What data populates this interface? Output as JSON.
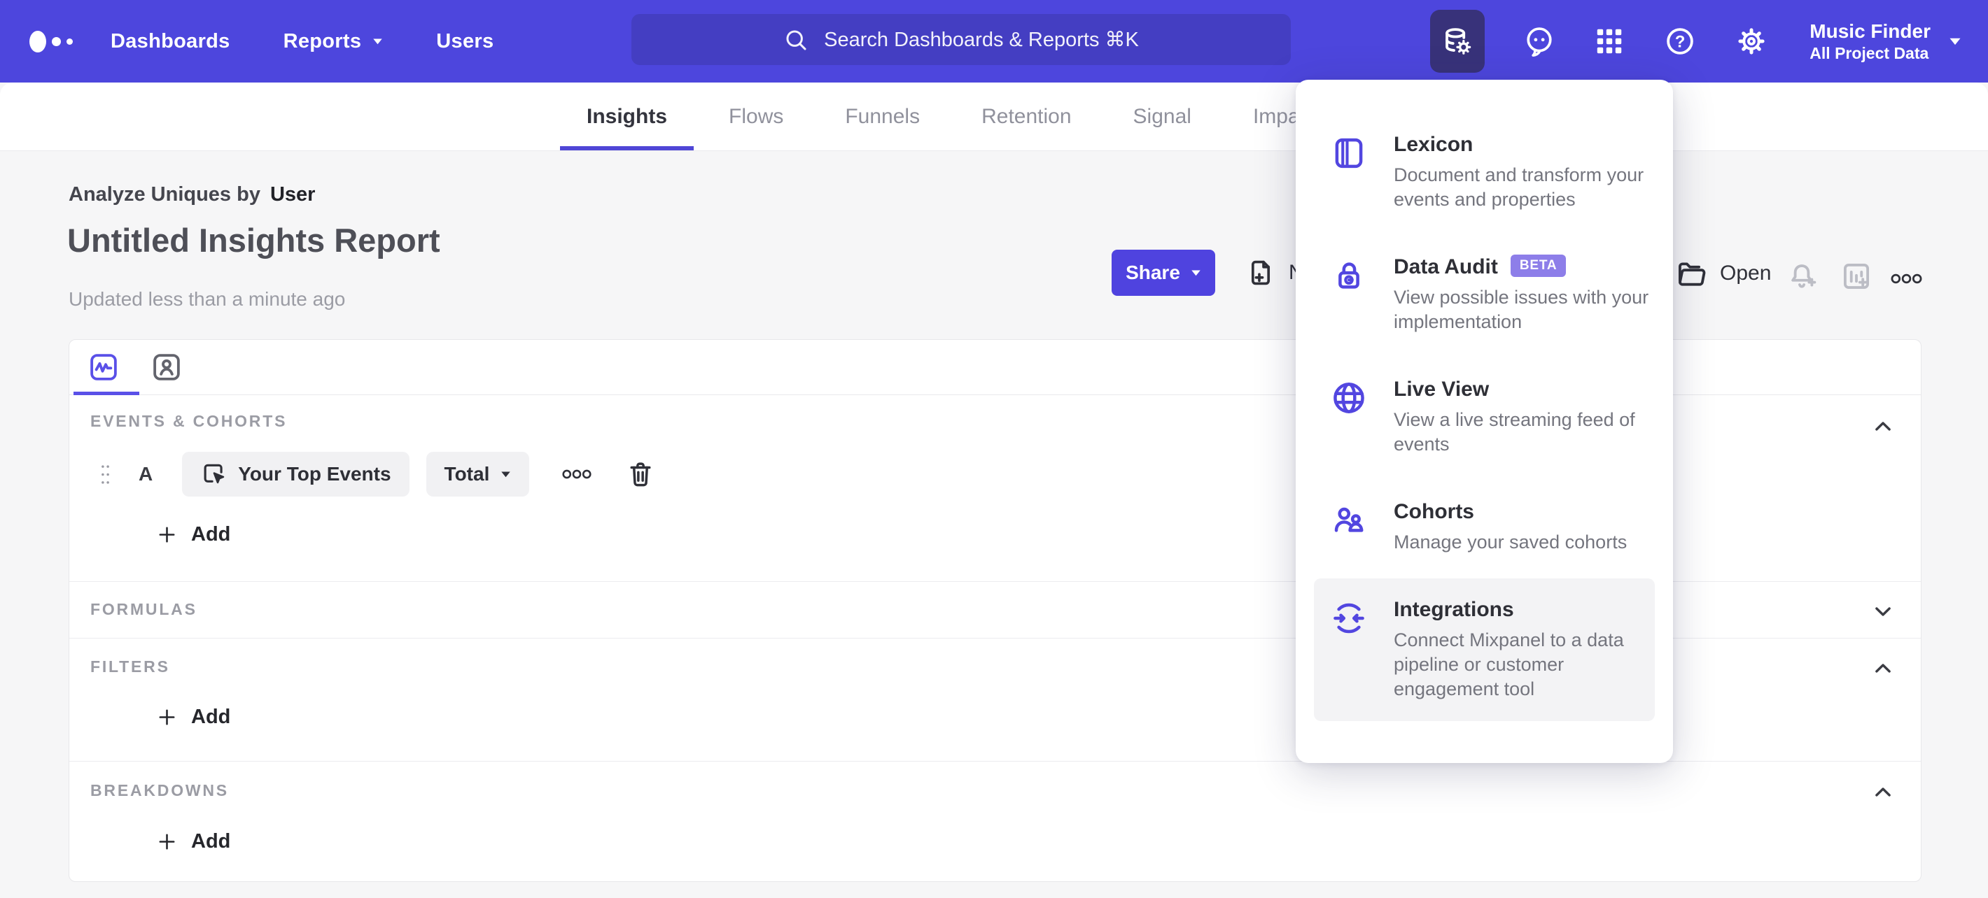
{
  "nav": {
    "items": [
      "Dashboards",
      "Reports",
      "Users"
    ],
    "search_placeholder": "Search Dashboards & Reports ⌘K",
    "project": {
      "name": "Music Finder",
      "scope": "All Project Data"
    }
  },
  "tabs": {
    "items": [
      "Insights",
      "Flows",
      "Funnels",
      "Retention",
      "Signal",
      "Impact"
    ],
    "active": "Insights"
  },
  "report": {
    "analyze_label": "Analyze Uniques by",
    "analyze_value": "User",
    "title": "Untitled Insights Report",
    "updated": "Updated less than a minute ago",
    "actions": {
      "share": "Share",
      "new": "New",
      "open": "Open"
    }
  },
  "builder": {
    "events_header": "EVENTS & COHORTS",
    "row": {
      "letter": "A",
      "event": "Your Top Events",
      "metric": "Total"
    },
    "add_label": "Add",
    "formulas_header": "FORMULAS",
    "filters_header": "FILTERS",
    "breakdowns_header": "BREAKDOWNS"
  },
  "menu": {
    "items": [
      {
        "title": "Lexicon",
        "description": "Document and transform your events and properties"
      },
      {
        "title": "Data Audit",
        "badge": "BETA",
        "description": "View possible issues with your implementation"
      },
      {
        "title": "Live View",
        "description": "View a live streaming feed of events"
      },
      {
        "title": "Cohorts",
        "description": "Manage your saved cohorts"
      },
      {
        "title": "Integrations",
        "description": "Connect Mixpanel to a data pipeline or customer engagement tool"
      }
    ]
  },
  "colors": {
    "nav_bg": "#4D46DD",
    "search_bg": "#443EC2",
    "active_tile_bg": "#38327A",
    "accent_purple": "#4F43DF",
    "icon_purple": "#5246E0",
    "beta_badge_bg": "#8D7EE9",
    "page_bg": "#F6F6F7"
  }
}
